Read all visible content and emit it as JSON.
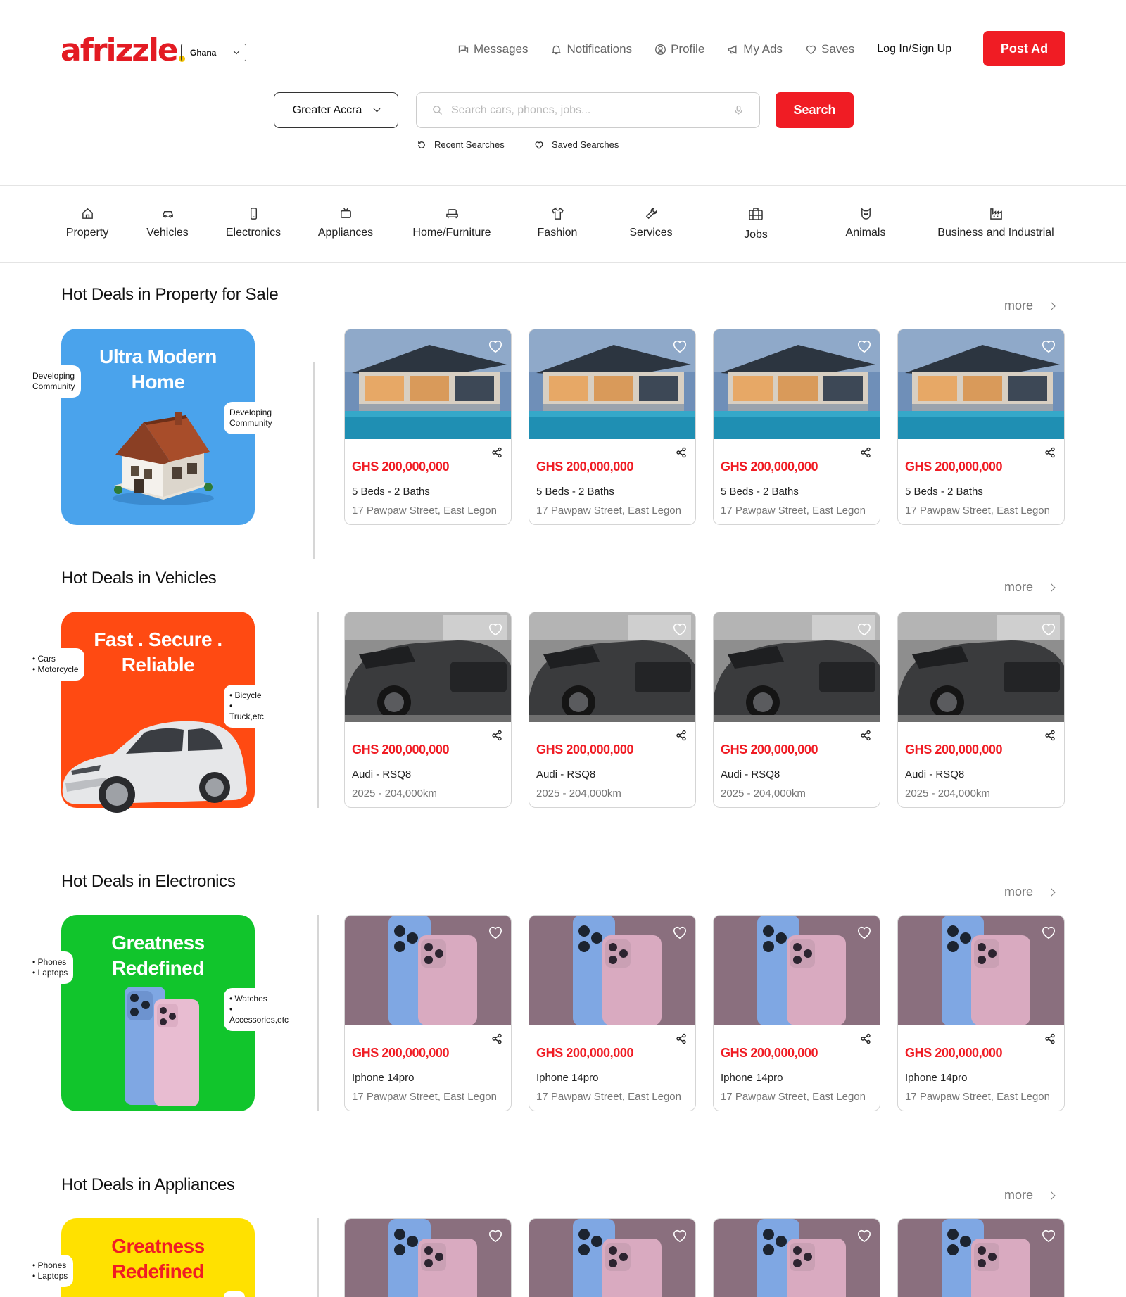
{
  "brand": {
    "logo_text": "afrizzle",
    "country": "Ghana",
    "brand_color": "#f01c24"
  },
  "topnav": [
    {
      "label": "Messages",
      "icon": "messages-icon"
    },
    {
      "label": "Notifications",
      "icon": "bell-icon"
    },
    {
      "label": "Profile",
      "icon": "profile-icon"
    },
    {
      "label": "My Ads",
      "icon": "megaphone-icon"
    },
    {
      "label": "Saves",
      "icon": "heart-icon"
    }
  ],
  "login_label": "Log In/Sign Up",
  "post_ad_label": "Post Ad",
  "search": {
    "region": "Greater Accra",
    "placeholder": "Search cars, phones, jobs...",
    "button": "Search",
    "recent": "Recent Searches",
    "saved": "Saved Searches"
  },
  "categories": [
    {
      "label": "Property",
      "icon": "house-icon"
    },
    {
      "label": "Vehicles",
      "icon": "car-icon"
    },
    {
      "label": "Electronics",
      "icon": "phone-icon"
    },
    {
      "label": "Appliances",
      "icon": "tv-icon"
    },
    {
      "label": "Home/Furniture",
      "icon": "sofa-icon"
    },
    {
      "label": "Fashion",
      "icon": "shirt-icon"
    },
    {
      "label": "Services",
      "icon": "wrench-icon"
    },
    {
      "label": "Jobs",
      "icon": "briefcase-icon"
    },
    {
      "label": "Animals",
      "icon": "cat-icon"
    },
    {
      "label": "Business and Industrial",
      "icon": "factory-icon"
    }
  ],
  "more_label": "more",
  "sections": [
    {
      "title": "Hot Deals in Property for Sale",
      "banner": {
        "line1": "Ultra Modern",
        "line2": "Home",
        "color": "#4aa3ec",
        "title_color": "#ffffff",
        "tag_left": [
          "Developing",
          "Community"
        ],
        "tag_right": [
          "Developing",
          "Community"
        ]
      },
      "listing": {
        "price": "GHS 200,000,000",
        "line1": "5 Beds - 2 Baths",
        "line2": "17 Pawpaw Street, East Legon"
      }
    },
    {
      "title": "Hot Deals in Vehicles",
      "banner": {
        "line1": "Fast . Secure .",
        "line2": "Reliable",
        "color": "#ff4a12",
        "title_color": "#ffffff",
        "tag_left": [
          "Cars",
          "Motorcycle"
        ],
        "tag_right": [
          "Bicycle",
          "Truck,etc"
        ]
      },
      "listing": {
        "price": "GHS 200,000,000",
        "line1": "Audi - RSQ8",
        "line2": "2025 - 204,000km"
      }
    },
    {
      "title": "Hot Deals in Electronics",
      "banner": {
        "line1": "Greatness",
        "line2": "Redefined",
        "color": "#11c52c",
        "title_color": "#ffffff",
        "tag_left": [
          "Phones",
          "Laptops"
        ],
        "tag_right": [
          "Watches",
          "Accessories,etc"
        ]
      },
      "listing": {
        "price": "GHS 200,000,000",
        "line1": "Iphone 14pro",
        "line2": "17 Pawpaw Street, East Legon"
      }
    },
    {
      "title": "Hot Deals in Appliances",
      "banner": {
        "line1": "Greatness",
        "line2": "Redefined",
        "color": "#ffe100",
        "title_color": "#f01c24",
        "tag_left": [
          "Phones",
          "Laptops"
        ],
        "tag_right": []
      },
      "listing": {
        "price": "",
        "line1": "",
        "line2": ""
      }
    }
  ]
}
